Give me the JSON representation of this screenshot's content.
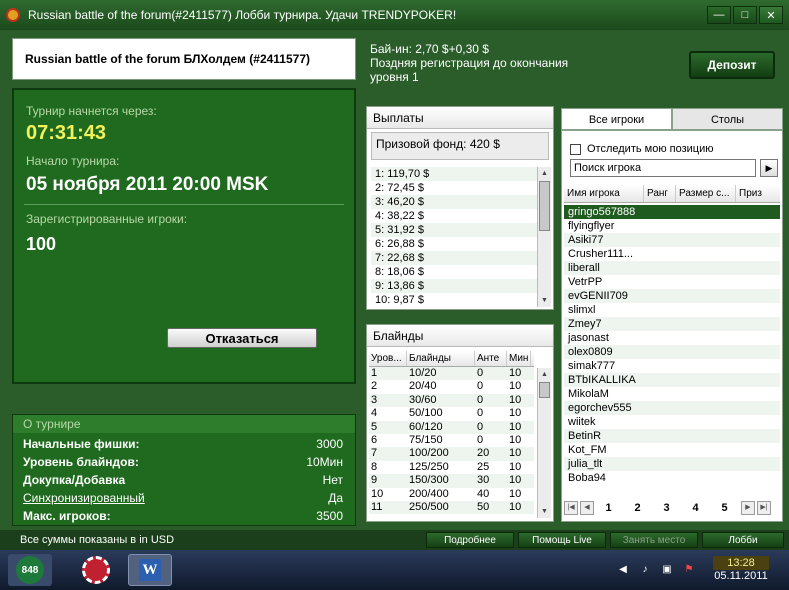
{
  "window": {
    "title": "Russian battle of the forum(#2411577) Лобби турнира. Удачи TRENDYPOKER!",
    "min": "—",
    "max": "□",
    "close": "✕"
  },
  "header": {
    "tournament_name": "Russian battle of the forum БЛХолдем (#2411577)",
    "buyin": "Бай-ин: 2,70 $+0,30 $",
    "late_reg": "Поздняя регистрация до окончания уровня 1",
    "deposit_label": "Депозит"
  },
  "status_panel": {
    "starts_in_label": "Турнир начнется через:",
    "countdown": "07:31:43",
    "start_label": "Начало турнира:",
    "start_value": "05 ноября 2011  20:00 MSK",
    "registered_label": "Зарегистрированные игроки:",
    "registered_value": "100",
    "decline_label": "Отказаться"
  },
  "about": {
    "title": "О турнире",
    "rows": [
      {
        "k": "Начальные фишки:",
        "v": "3000"
      },
      {
        "k": "Уровень блайндов:",
        "v": "10Мин"
      },
      {
        "k": "Докупка/Добавка",
        "v": "Нет"
      },
      {
        "k": "Синхронизированный",
        "v": "Да"
      },
      {
        "k": "Макс. игроков:",
        "v": "3500"
      }
    ]
  },
  "payouts": {
    "title": "Выплаты",
    "prize_pool": "Призовой фонд: 420 $",
    "rows": [
      "1: 119,70 $",
      "2: 72,45 $",
      "3: 46,20 $",
      "4: 38,22 $",
      "5: 31,92 $",
      "6: 26,88 $",
      "7: 22,68 $",
      "8: 18,06 $",
      "9: 13,86 $",
      "10: 9,87 $"
    ]
  },
  "blinds": {
    "title": "Блайнды",
    "headers": [
      "Уров...",
      "Блайнды",
      "Анте",
      "Мин"
    ],
    "rows": [
      [
        "1",
        "10/20",
        "0",
        "10"
      ],
      [
        "2",
        "20/40",
        "0",
        "10"
      ],
      [
        "3",
        "30/60",
        "0",
        "10"
      ],
      [
        "4",
        "50/100",
        "0",
        "10"
      ],
      [
        "5",
        "60/120",
        "0",
        "10"
      ],
      [
        "6",
        "75/150",
        "0",
        "10"
      ],
      [
        "7",
        "100/200",
        "20",
        "10"
      ],
      [
        "8",
        "125/250",
        "25",
        "10"
      ],
      [
        "9",
        "150/300",
        "30",
        "10"
      ],
      [
        "10",
        "200/400",
        "40",
        "10"
      ],
      [
        "11",
        "250/500",
        "50",
        "10"
      ]
    ]
  },
  "players": {
    "tab_players": "Все игроки",
    "tab_tables": "Столы",
    "track_label": "Отследить мою позицию",
    "search_placeholder": "Поиск игрока",
    "headers": [
      "Имя игрока",
      "Ранг",
      "Размер с...",
      "Приз"
    ],
    "list": [
      "gringo567888",
      "flyingflyer",
      "Asiki77",
      "Crusher111...",
      "liberall",
      "VetrPP",
      "evGENII709",
      "slimxl",
      "Zmey7",
      "jasonast",
      "olex0809",
      "simak777",
      "BTbIKALLIKA",
      "MikolaM",
      "egorchev555",
      "wiitek",
      "BetinR",
      "Kot_FM",
      "julia_tlt",
      "Boba94"
    ],
    "pages": [
      "1",
      "2",
      "3",
      "4",
      "5"
    ]
  },
  "statusbar": {
    "message": "Все суммы показаны в in USD",
    "more": "Подробнее",
    "help": "Помощь Live",
    "take_seat": "Занять место",
    "lobby": "Лобби"
  },
  "taskbar": {
    "app_848": "848",
    "word_letter": "W",
    "time": "13:28",
    "date": "05.11.2011"
  }
}
